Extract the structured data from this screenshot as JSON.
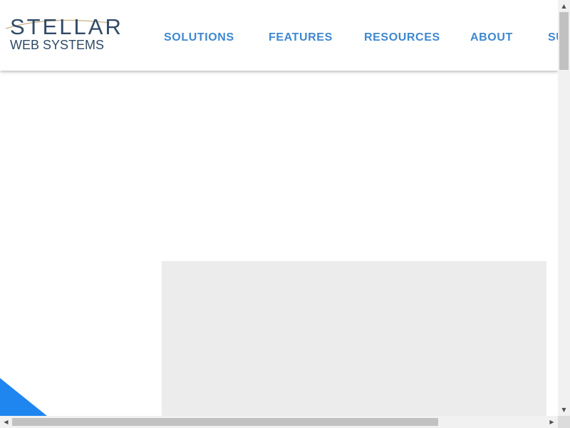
{
  "brand": {
    "name_line1": "STELLAR",
    "name_line2": "WEB SYSTEMS",
    "text_color": "#2f4a66",
    "swoosh_color": "#c9b48a"
  },
  "nav": {
    "color": "#3e88d1",
    "items": [
      {
        "label": "SOLUTIONS"
      },
      {
        "label": "FEATURES"
      },
      {
        "label": "RESOURCES"
      },
      {
        "label": "ABOUT"
      },
      {
        "label": "SU"
      }
    ]
  },
  "content": {
    "panel_color": "#ececec",
    "accent_color": "#1f86f0"
  },
  "scrollbars": {
    "up_icon": "▲",
    "down_icon": "▼",
    "left_icon": "◀",
    "right_icon": "▶"
  }
}
